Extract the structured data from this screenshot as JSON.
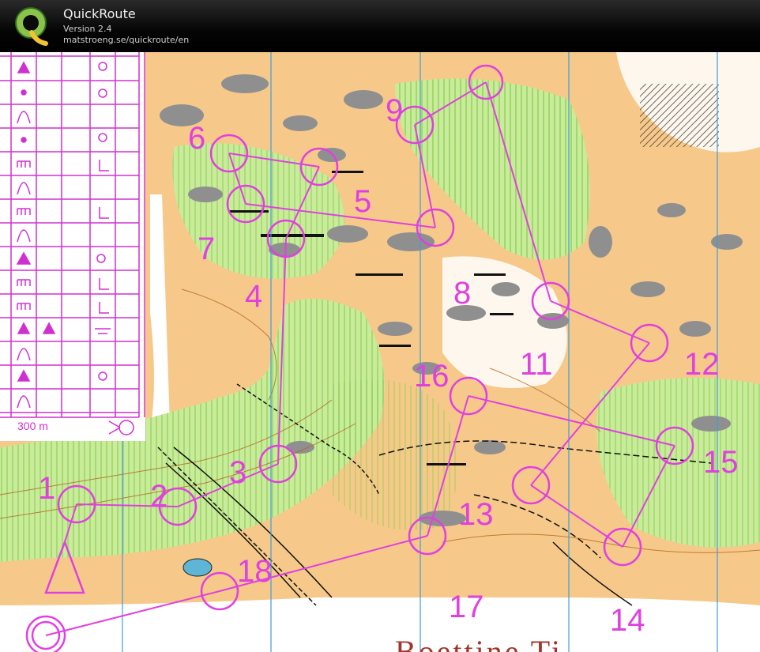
{
  "window": {
    "title": "QuickRoute",
    "version": "Version 2.4",
    "url": "matstroeng.se/quickroute/en"
  },
  "map": {
    "controls": [
      {
        "num": "1",
        "label": "1"
      },
      {
        "num": "2",
        "label": "2"
      },
      {
        "num": "3",
        "label": "3"
      },
      {
        "num": "4",
        "label": "4"
      },
      {
        "num": "5",
        "label": "5"
      },
      {
        "num": "6",
        "label": "6"
      },
      {
        "num": "7",
        "label": "7"
      },
      {
        "num": "8",
        "label": "8"
      },
      {
        "num": "9",
        "label": "9"
      },
      {
        "num": "11",
        "label": "11"
      },
      {
        "num": "12",
        "label": "12"
      },
      {
        "num": "13",
        "label": "13"
      },
      {
        "num": "14",
        "label": "14"
      },
      {
        "num": "15",
        "label": "15"
      },
      {
        "num": "16",
        "label": "16"
      },
      {
        "num": "17",
        "label": "17"
      },
      {
        "num": "18",
        "label": "18"
      }
    ],
    "scale_text": "300 m",
    "bottom_label": "Boettine Ti...",
    "colors": {
      "course": "#e040e0",
      "forest": "#ffffff",
      "open": "#f6c98a",
      "green": "#9fdc6a",
      "rock": "#8f8f8f",
      "lake": "#5fb5d6",
      "meridian": "#3f9ddc"
    }
  }
}
